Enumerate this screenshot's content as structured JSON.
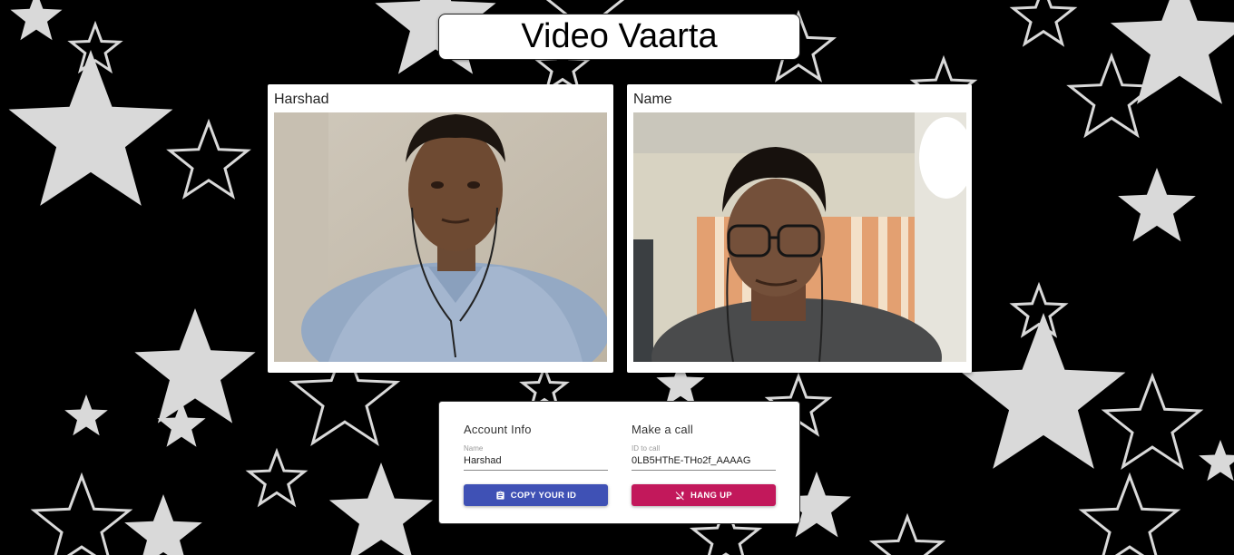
{
  "app": {
    "title": "Video Vaarta"
  },
  "videos": {
    "local": {
      "label": "Harshad"
    },
    "remote": {
      "label": "Name"
    }
  },
  "account": {
    "heading": "Account Info",
    "name_label": "Name",
    "name_value": "Harshad",
    "copy_button": "COPY YOUR ID",
    "copy_icon": "clipboard-icon"
  },
  "call": {
    "heading": "Make a call",
    "id_label": "ID to call",
    "id_value": "0LB5HThE-THo2f_AAAAG",
    "hangup_button": "HANG UP",
    "hangup_icon": "phone-disabled-icon"
  },
  "colors": {
    "copy_button": "#3f51b5",
    "hangup_button": "#c2185b",
    "background": "#000000",
    "stars": "#d9d9d9"
  }
}
